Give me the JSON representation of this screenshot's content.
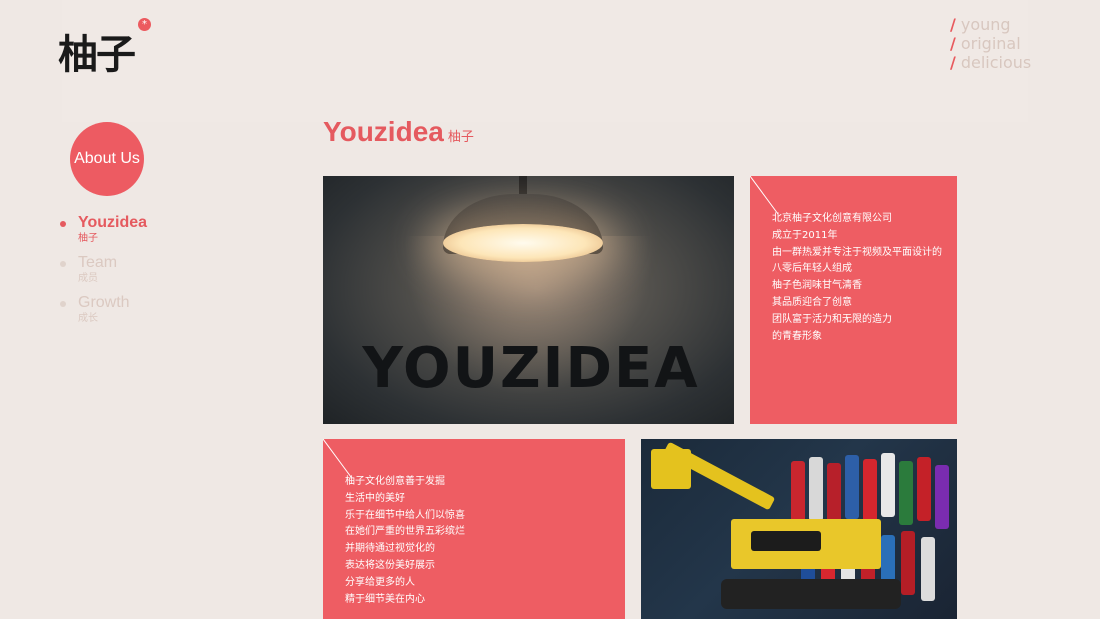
{
  "brand": {
    "logo_text": "柚子",
    "logo_mark": "*"
  },
  "tagline": {
    "lines": [
      "young",
      "original",
      "delicious"
    ],
    "slash": "/"
  },
  "about": {
    "label": "About Us"
  },
  "nav": {
    "items": [
      {
        "en": "Youzidea",
        "zh": "柚子",
        "active": true
      },
      {
        "en": "Team",
        "zh": "成员",
        "active": false
      },
      {
        "en": "Growth",
        "zh": "成长",
        "active": false
      }
    ]
  },
  "heading": {
    "en": "Youzidea",
    "zh": "柚子"
  },
  "photos": {
    "lamp": {
      "wall_text": "YOUZIDEA"
    }
  },
  "card1": {
    "lines": [
      "北京柚子文化创意有限公司",
      "成立于2011年",
      "由一群热爱并专注于视频及平面设计的",
      "八零后年轻人组成",
      "柚子色润味甘气清香",
      "其品质迎合了创意",
      "团队富于活力和无限的造力",
      "的青春形象"
    ]
  },
  "card2": {
    "lines": [
      "柚子文化创意善于发掘",
      "生活中的美好",
      "乐于在细节中给人们以惊喜",
      "在她们严重的世界五彩缤烂",
      "并期待通过视觉化的",
      "表达将这份美好展示",
      "分享给更多的人",
      "精于细节美在内心"
    ]
  },
  "colors": {
    "accent": "#ee5d63",
    "background": "#efe8e4",
    "muted": "#dbc9c1"
  }
}
